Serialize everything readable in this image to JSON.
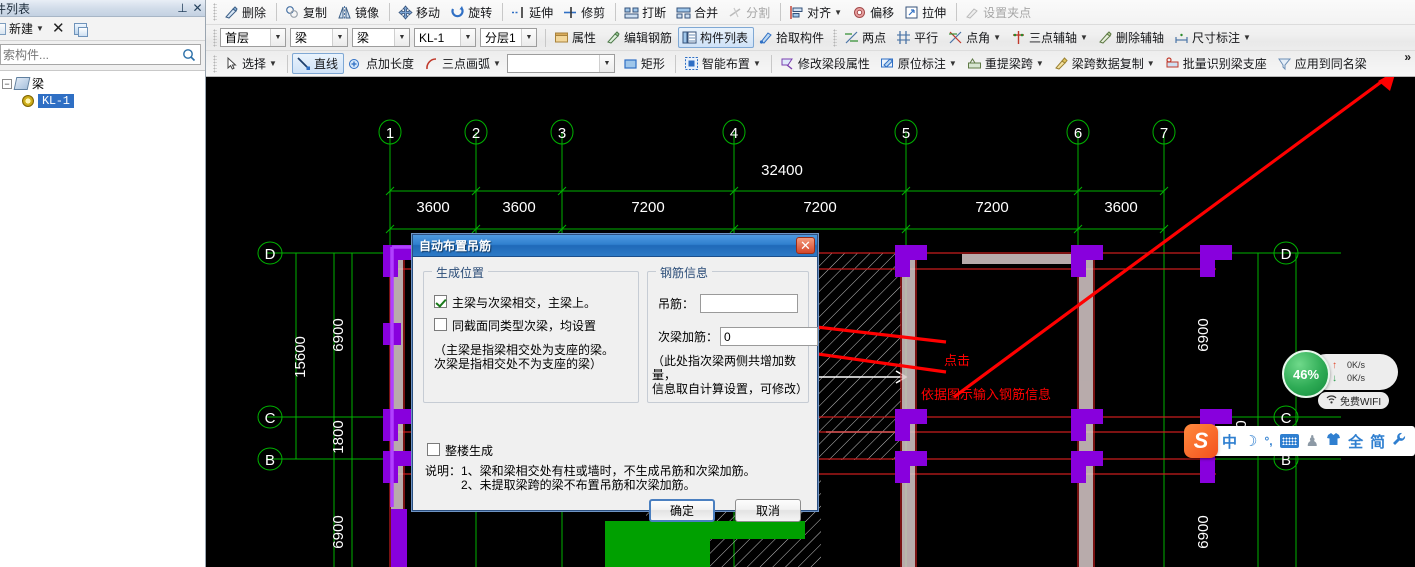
{
  "left_panel": {
    "title": "件列表",
    "pin_icon": "pin-icon",
    "close_icon": "close-icon",
    "new_label": "新建",
    "delete_icon": "delete-x-icon",
    "copy_icon": "copy-icon",
    "search_placeholder": "索构件...",
    "search_value": "",
    "search_icon": "search-icon",
    "tree": [
      {
        "label": "梁",
        "level": 1,
        "expander": "-",
        "icon": "beam-icon",
        "selected": false
      },
      {
        "label": "KL-1",
        "level": 2,
        "expander": "",
        "icon": "member-icon",
        "selected": true
      }
    ]
  },
  "toolbars": {
    "more_label": "»",
    "row1": [
      {
        "label": "删除",
        "icon": "delete-icon",
        "sep_before": false,
        "dots_before": true
      },
      {
        "label": "复制",
        "icon": "copy-icon",
        "sep_before": true
      },
      {
        "label": "镜像",
        "icon": "mirror-icon"
      },
      {
        "label": "移动",
        "icon": "move-icon",
        "sep_before": true
      },
      {
        "label": "旋转",
        "icon": "rotate-icon"
      },
      {
        "label": "延伸",
        "icon": "extend-icon",
        "sep_before": true
      },
      {
        "label": "修剪",
        "icon": "trim-icon"
      },
      {
        "label": "打断",
        "icon": "break-icon",
        "sep_before": true
      },
      {
        "label": "合并",
        "icon": "merge-icon"
      },
      {
        "label": "分割",
        "icon": "split-icon",
        "disabled": true
      },
      {
        "label": "对齐",
        "icon": "align-icon",
        "sep_before": true,
        "caret": true
      },
      {
        "label": "偏移",
        "icon": "offset-icon"
      },
      {
        "label": "拉伸",
        "icon": "stretch-icon"
      },
      {
        "label": "设置夹点",
        "icon": "gripset-icon",
        "disabled": true,
        "sep_before": true
      }
    ],
    "row2_combos": [
      {
        "value": "首层",
        "width": "w66",
        "name": "floor-select"
      },
      {
        "value": "梁",
        "width": "w58",
        "name": "category-select"
      },
      {
        "value": "梁",
        "width": "w58",
        "name": "member-type-select"
      },
      {
        "value": "KL-1",
        "width": "w62",
        "name": "member-select"
      },
      {
        "value": "分层1",
        "width": "w57",
        "name": "layer-select"
      }
    ],
    "row2_items": [
      {
        "label": "属性",
        "icon": "properties-icon"
      },
      {
        "label": "编辑钢筋",
        "icon": "edit-rebar-icon"
      },
      {
        "label": "构件列表",
        "icon": "member-list-icon",
        "active": true
      },
      {
        "label": "拾取构件",
        "icon": "pick-member-icon"
      },
      {
        "label": "两点",
        "icon": "two-point-icon",
        "dots_before": true
      },
      {
        "label": "平行",
        "icon": "parallel-icon"
      },
      {
        "label": "点角",
        "icon": "point-angle-icon",
        "caret": true
      },
      {
        "label": "三点辅轴",
        "icon": "three-point-axis-icon",
        "caret": true
      },
      {
        "label": "删除辅轴",
        "icon": "delete-axis-icon"
      },
      {
        "label": "尺寸标注",
        "icon": "dimension-icon",
        "caret": true
      }
    ],
    "row3": [
      {
        "label": "选择",
        "icon": "select-icon",
        "caret": true,
        "dots_before": true
      },
      {
        "label": "直线",
        "icon": "line-icon",
        "active": true,
        "sep_before": true
      },
      {
        "label": "点加长度",
        "icon": "point-length-icon"
      },
      {
        "label": "三点画弧",
        "icon": "arc-icon",
        "caret": true
      },
      {
        "label": "",
        "icon": "",
        "combo_blank": true
      },
      {
        "label": "矩形",
        "icon": "rect-icon"
      },
      {
        "label": "智能布置",
        "icon": "smart-layout-icon",
        "caret": true,
        "sep_before": true
      },
      {
        "label": "修改梁段属性",
        "icon": "edit-beam-seg-icon",
        "sep_before": true
      },
      {
        "label": "原位标注",
        "icon": "inplace-note-icon",
        "caret": true
      },
      {
        "label": "重提梁跨",
        "icon": "re-extract-span-icon",
        "caret": true
      },
      {
        "label": "梁跨数据复制",
        "icon": "span-data-copy-icon",
        "caret": true
      },
      {
        "label": "批量识别梁支座",
        "icon": "batch-support-icon"
      },
      {
        "label": "应用到同名梁",
        "icon": "apply-same-name-icon"
      }
    ]
  },
  "dialog": {
    "title": "自动布置吊筋",
    "close_icon": "close-icon",
    "group_position": {
      "legend": "生成位置",
      "checkboxes": [
        {
          "label": "主梁与次梁相交，主梁上。",
          "checked": true,
          "name": "primary-secondary-intersect"
        },
        {
          "label": "同截面同类型次梁，均设置",
          "checked": false,
          "name": "same-section-secondary"
        }
      ],
      "note_lines": [
        "（主梁是指梁相交处为支座的梁。",
        "次梁是指相交处不为支座的梁）"
      ]
    },
    "group_rebar": {
      "legend": "钢筋信息",
      "fields": [
        {
          "label": "吊筋：",
          "value": "",
          "name": "hanging-rebar-field"
        },
        {
          "label": "次梁加筋：",
          "value": "0",
          "name": "secondary-stirrup-field"
        }
      ],
      "note_lines": [
        "（此处指次梁两侧共增加数量，",
        "信息取自计算设置，可修改）"
      ]
    },
    "whole_building": {
      "label": "整楼生成",
      "checked": false
    },
    "description_lines": [
      "说明：1、梁和梁相交处有柱或墙时，不生成吊筋和次梁加筋。",
      "　　　2、未提取梁跨的梁不布置吊筋和次梁加筋。"
    ],
    "ok_label": "确定",
    "cancel_label": "取消"
  },
  "canvas": {
    "background": "#000000",
    "axis_color": "#00c000",
    "annotation_color": "#ff0000",
    "total_dimension": "32400",
    "column_labels": [
      "1",
      "2",
      "3",
      "4",
      "5",
      "6",
      "7"
    ],
    "column_spans": [
      "3600",
      "3600",
      "7200",
      "7200",
      "7200",
      "3600"
    ],
    "row_labels_left": [
      "D",
      "C",
      "B"
    ],
    "row_labels_right": [
      "D",
      "C",
      "B"
    ],
    "vertical_dims": [
      "6900",
      "1800",
      "6900"
    ],
    "vertical_total": "15600",
    "right_vertical_dims": [
      "6900",
      "1800",
      "6900"
    ],
    "annotations": [
      {
        "text": "点击",
        "name": "annotation-click"
      },
      {
        "text": "依据图示输入钢筋信息",
        "name": "annotation-enter-rebar-info"
      }
    ]
  },
  "netspeed": {
    "percent": "46%",
    "upload": "0K/s",
    "download": "0K/s",
    "up_icon": "arrow-up-icon",
    "down_icon": "arrow-down-icon",
    "wifi_label": "免费WIFI",
    "wifi_icon": "wifi-icon"
  },
  "ime_bar": {
    "logo": "S",
    "items": [
      {
        "glyph": "中",
        "name": "ime-chinese-mode"
      },
      {
        "glyph": "☽",
        "name": "ime-moon-icon"
      },
      {
        "glyph": "°,",
        "name": "ime-punctuation-icon"
      },
      {
        "glyph": "",
        "name": "ime-keyboard-icon"
      },
      {
        "glyph": "♟",
        "name": "ime-user-icon"
      },
      {
        "glyph": "👕",
        "name": "ime-skin-icon"
      },
      {
        "glyph": "全",
        "name": "ime-fullwidth-icon"
      },
      {
        "glyph": "简",
        "name": "ime-simplified-icon"
      },
      {
        "glyph": "🔧",
        "name": "ime-toolbox-icon"
      }
    ]
  }
}
